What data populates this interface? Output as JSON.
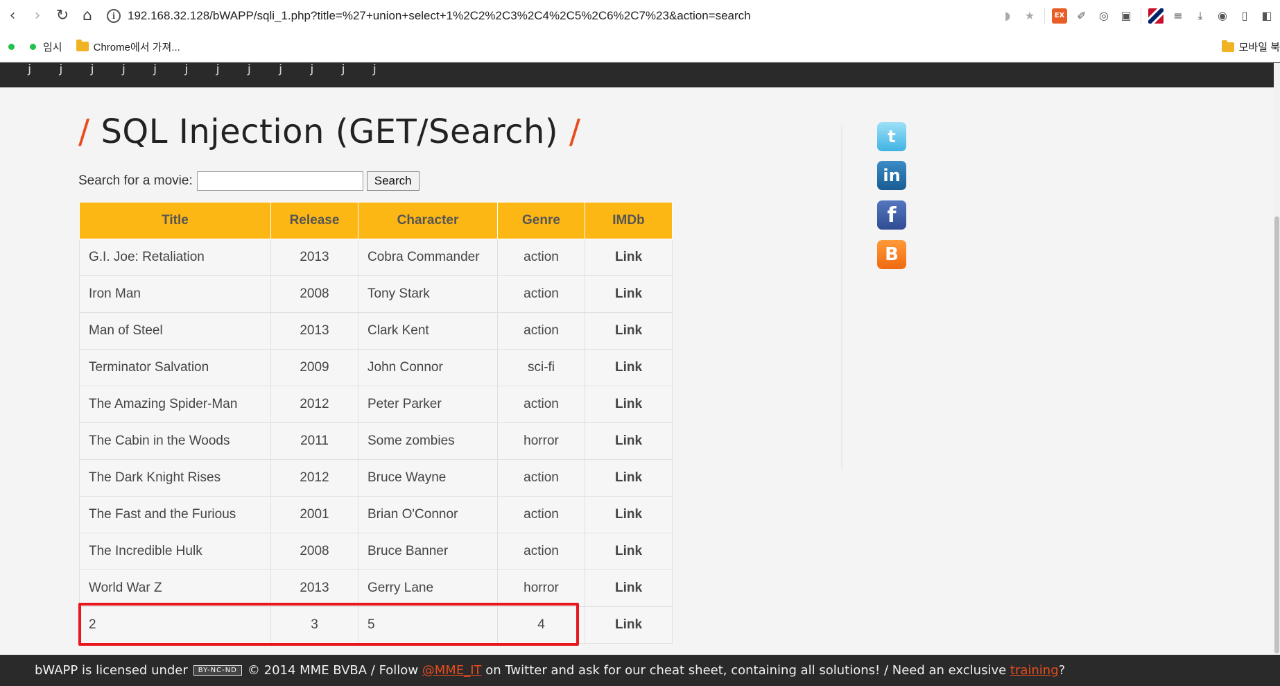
{
  "browser": {
    "url": "192.168.32.128/bWAPP/sqli_1.php?title=%27+union+select+1%2C2%2C3%2C4%2C5%2C6%2C7%23&action=search",
    "bookmarks": [
      "임시",
      "Chrome에서 가져..."
    ],
    "bookmarks_right": "모바일 북"
  },
  "page": {
    "title": "SQL Injection (GET/Search)",
    "slash": "/",
    "search_label": "Search for a movie:",
    "search_value": "",
    "search_button": "Search"
  },
  "table": {
    "headers": [
      "Title",
      "Release",
      "Character",
      "Genre",
      "IMDb"
    ],
    "rows": [
      {
        "title": "G.I. Joe: Retaliation",
        "release": "2013",
        "character": "Cobra Commander",
        "genre": "action",
        "imdb": "Link"
      },
      {
        "title": "Iron Man",
        "release": "2008",
        "character": "Tony Stark",
        "genre": "action",
        "imdb": "Link"
      },
      {
        "title": "Man of Steel",
        "release": "2013",
        "character": "Clark Kent",
        "genre": "action",
        "imdb": "Link"
      },
      {
        "title": "Terminator Salvation",
        "release": "2009",
        "character": "John Connor",
        "genre": "sci-fi",
        "imdb": "Link"
      },
      {
        "title": "The Amazing Spider-Man",
        "release": "2012",
        "character": "Peter Parker",
        "genre": "action",
        "imdb": "Link"
      },
      {
        "title": "The Cabin in the Woods",
        "release": "2011",
        "character": "Some zombies",
        "genre": "horror",
        "imdb": "Link"
      },
      {
        "title": "The Dark Knight Rises",
        "release": "2012",
        "character": "Bruce Wayne",
        "genre": "action",
        "imdb": "Link"
      },
      {
        "title": "The Fast and the Furious",
        "release": "2001",
        "character": "Brian O'Connor",
        "genre": "action",
        "imdb": "Link"
      },
      {
        "title": "The Incredible Hulk",
        "release": "2008",
        "character": "Bruce Banner",
        "genre": "action",
        "imdb": "Link"
      },
      {
        "title": "World War Z",
        "release": "2013",
        "character": "Gerry Lane",
        "genre": "horror",
        "imdb": "Link"
      },
      {
        "title": "2",
        "release": "3",
        "character": "5",
        "genre": "4",
        "imdb": "Link"
      }
    ]
  },
  "social": {
    "twitter": "t",
    "linkedin": "in",
    "facebook": "f",
    "blogger": "B"
  },
  "footer": {
    "text1": "bWAPP is licensed under",
    "cc_badge": "BY-NC-ND",
    "text2": "© 2014 MME BVBA / Follow",
    "twitter_handle": "@MME_IT",
    "text3": "on Twitter and ask for our cheat sheet, containing all solutions! / Need an exclusive",
    "training": "training",
    "text4": "?"
  }
}
